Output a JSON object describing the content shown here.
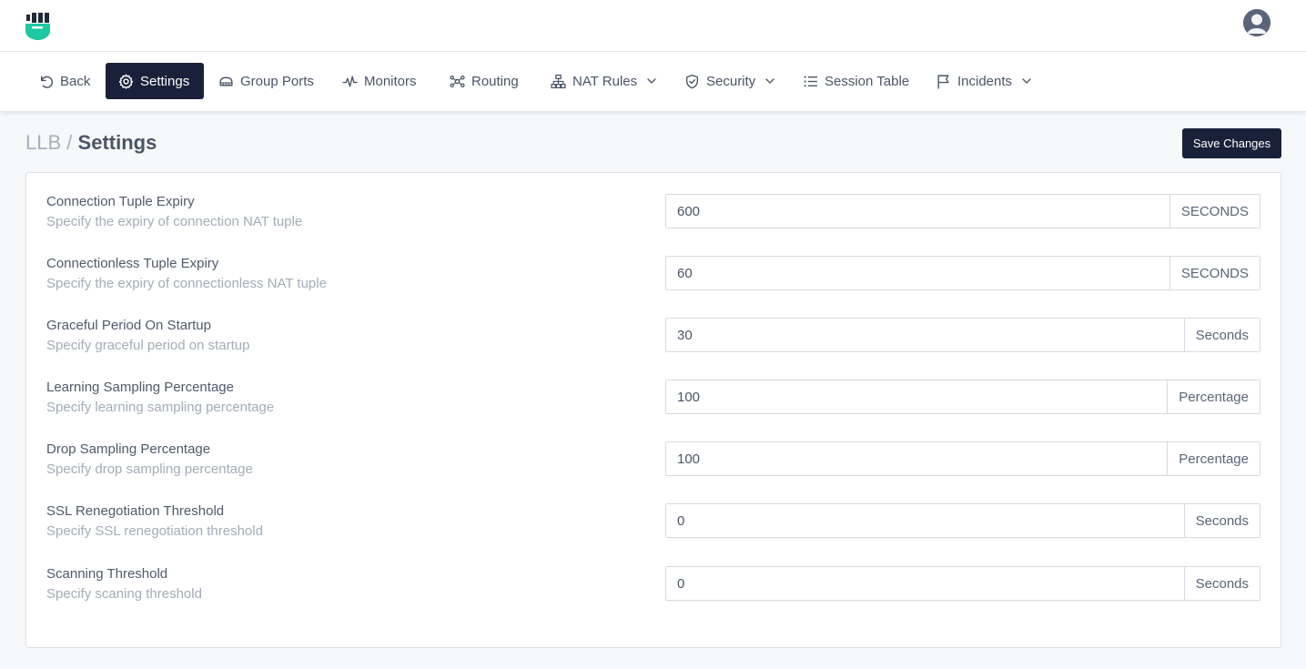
{
  "colors": {
    "accent": "#19213a",
    "brand": "#1ec8a0"
  },
  "nav": {
    "items": [
      {
        "label": "Back",
        "icon": "undo-icon"
      },
      {
        "label": "Settings",
        "icon": "gear-icon",
        "active": true
      },
      {
        "label": "Group Ports",
        "icon": "router-icon"
      },
      {
        "label": "Monitors",
        "icon": "pulse-icon"
      },
      {
        "label": "Routing",
        "icon": "network-icon"
      },
      {
        "label": "NAT Rules",
        "icon": "sitemap-icon",
        "dropdown": true
      },
      {
        "label": "Security",
        "icon": "shield-icon",
        "dropdown": true
      },
      {
        "label": "Session Table",
        "icon": "list-icon"
      },
      {
        "label": "Incidents",
        "icon": "flag-icon",
        "dropdown": true
      }
    ]
  },
  "breadcrumb": {
    "parent": "LLB",
    "separator": "/",
    "current": "Settings"
  },
  "save_label": "Save Changes",
  "settings": [
    {
      "label": "Connection Tuple Expiry",
      "description": "Specify the expiry of connection NAT tuple",
      "value": "600",
      "unit": "SECONDS"
    },
    {
      "label": "Connectionless Tuple Expiry",
      "description": "Specify the expiry of connectionless NAT tuple",
      "value": "60",
      "unit": "SECONDS"
    },
    {
      "label": "Graceful Period On Startup",
      "description": "Specify graceful period on startup",
      "value": "30",
      "unit": "Seconds"
    },
    {
      "label": "Learning Sampling Percentage",
      "description": "Specify learning sampling percentage",
      "value": "100",
      "unit": "Percentage"
    },
    {
      "label": "Drop Sampling Percentage",
      "description": "Specify drop sampling percentage",
      "value": "100",
      "unit": "Percentage"
    },
    {
      "label": "SSL Renegotiation Threshold",
      "description": "Specify SSL renegotiation threshold",
      "value": "0",
      "unit": "Seconds"
    },
    {
      "label": "Scanning Threshold",
      "description": "Specify scaning threshold",
      "value": "0",
      "unit": "Seconds"
    }
  ]
}
